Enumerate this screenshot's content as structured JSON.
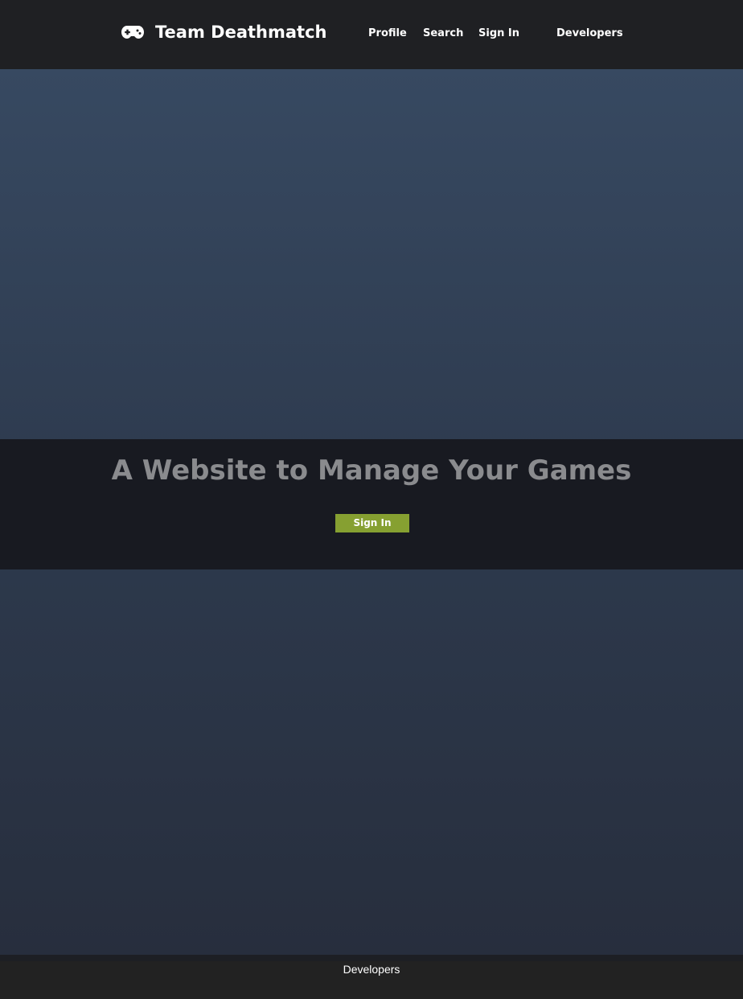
{
  "header": {
    "title": "Team Deathmatch",
    "logo_icon": "gamepad-icon",
    "nav": {
      "profile": "Profile",
      "search": "Search",
      "sign_in": "Sign In",
      "developers": "Developers"
    }
  },
  "hero": {
    "headline": "A Website to Manage Your Games",
    "button_label": "Sign In",
    "button_color": "#86a031"
  },
  "footer": {
    "link": "Developers"
  },
  "colors": {
    "navbar_bg": "#1f2023",
    "band_bg": "#181a21",
    "hero_top": "#374961",
    "hero_bottom": "#272e3d",
    "headline_text": "#8a8b8e"
  }
}
